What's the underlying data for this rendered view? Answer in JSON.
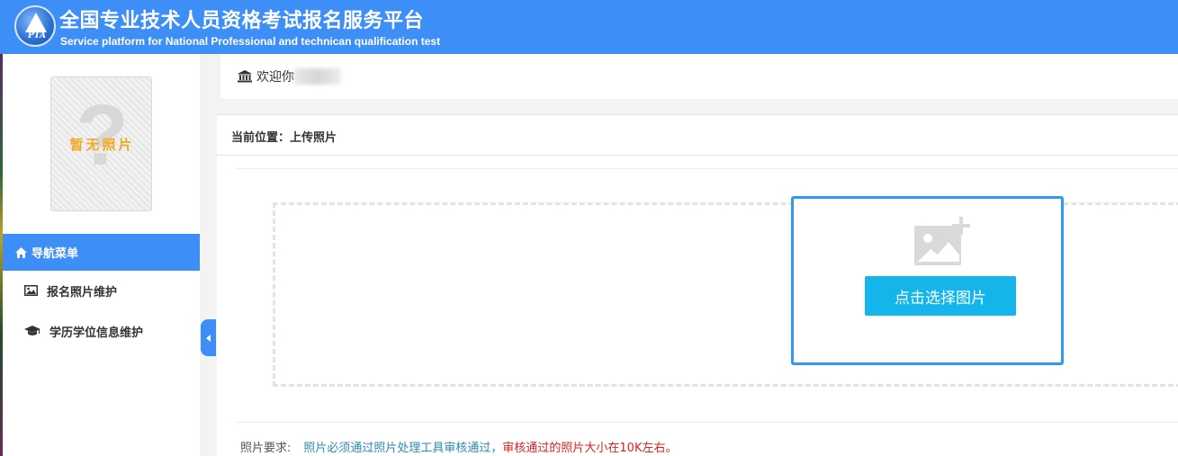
{
  "header": {
    "logo_text": "PTA",
    "title_cn": "全国专业技术人员资格考试报名服务平台",
    "title_en": "Service platform for National Professional and technican qualification test"
  },
  "sidebar": {
    "photo_placeholder": "暂无照片",
    "photo_glyph": "?",
    "nav_header": "导航菜单",
    "items": [
      {
        "label": "报名照片维护",
        "icon": "image-icon"
      },
      {
        "label": "学历学位信息维护",
        "icon": "graduation-cap-icon"
      }
    ]
  },
  "welcome": {
    "text": "欢迎你",
    "icon": "bank-icon"
  },
  "main": {
    "breadcrumb": "当前位置：上传照片",
    "choose_button": "点击选择图片",
    "requirement_label": "照片要求:",
    "requirement_part1": "照片必须通过照片处理工具审核通过，",
    "requirement_part2": "审核通过的照片大小在10K左右。"
  },
  "colors": {
    "header_blue": "#3e8ef7",
    "button_cyan": "#13b5ea",
    "upload_border": "#2f9bf0",
    "warning_red": "#e02020",
    "info_blue": "#2a8bb8",
    "placeholder_orange": "#f5a623"
  }
}
